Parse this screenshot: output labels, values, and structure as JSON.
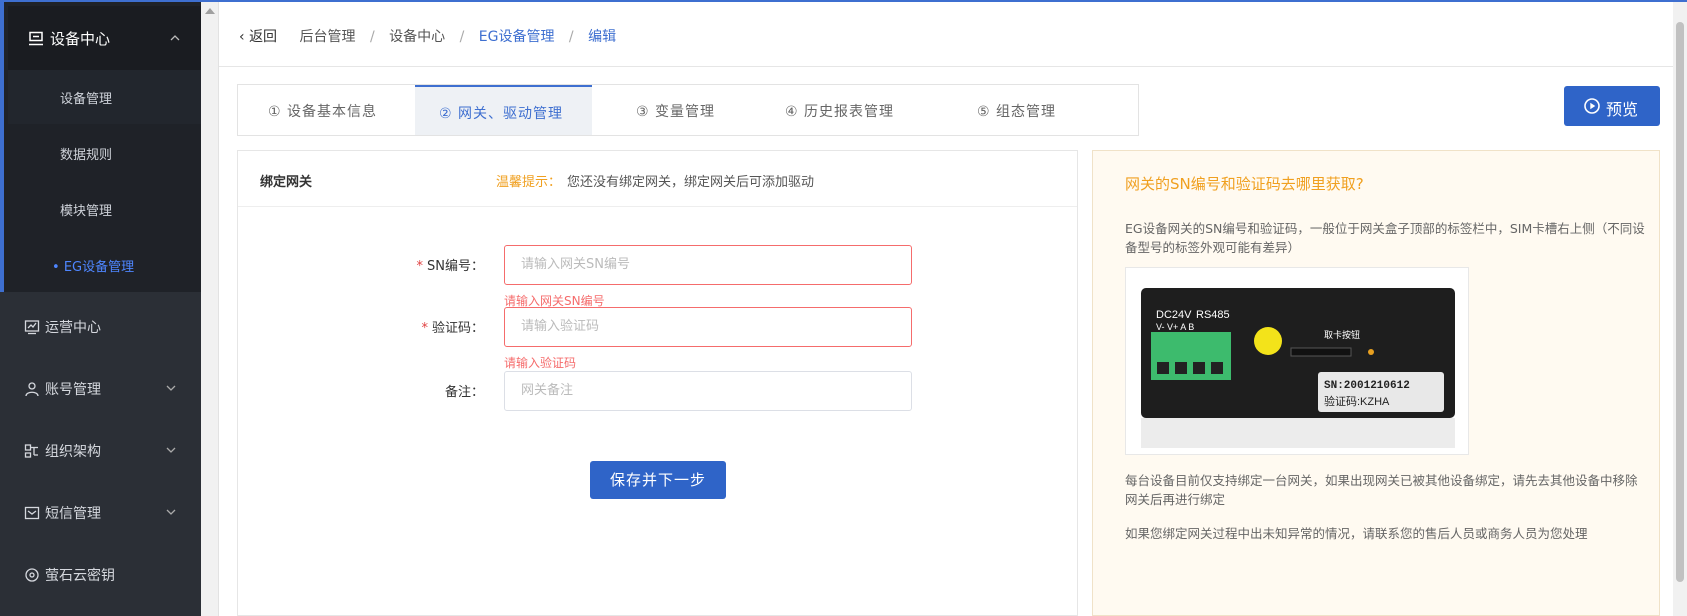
{
  "sidebar": {
    "open_group": {
      "label": "设备中心",
      "icon": "device-icon"
    },
    "sub_items": [
      {
        "label": "设备管理"
      },
      {
        "label": "数据规则"
      },
      {
        "label": "模块管理"
      },
      {
        "label": "EG设备管理",
        "active": true
      }
    ],
    "items": [
      {
        "label": "运营中心",
        "icon": "chart-icon",
        "has_chevron": false
      },
      {
        "label": "账号管理",
        "icon": "user-icon",
        "has_chevron": true
      },
      {
        "label": "组织架构",
        "icon": "org-icon",
        "has_chevron": true
      },
      {
        "label": "短信管理",
        "icon": "message-icon",
        "has_chevron": true
      },
      {
        "label": "萤石云密钥",
        "icon": "key-icon",
        "has_chevron": false
      }
    ]
  },
  "breadcrumb": {
    "back": "返回",
    "items": [
      "后台管理",
      "设备中心",
      "EG设备管理",
      "编辑"
    ]
  },
  "tabs": [
    {
      "label": "① 设备基本信息"
    },
    {
      "label": "② 网关、驱动管理",
      "active": true
    },
    {
      "label": "③ 变量管理"
    },
    {
      "label": "④ 历史报表管理"
    },
    {
      "label": "⑤ 组态管理"
    }
  ],
  "preview_button": "预览",
  "form": {
    "title": "绑定网关",
    "tip_label": "温馨提示：",
    "tip_text": "您还没有绑定网关，绑定网关后可添加驱动",
    "sn": {
      "label": "SN编号：",
      "placeholder": "请输入网关SN编号",
      "error": "请输入网关SN编号"
    },
    "code": {
      "label": "验证码：",
      "placeholder": "请输入验证码",
      "error": "请输入验证码"
    },
    "remark": {
      "label": "备注：",
      "placeholder": "网关备注"
    },
    "save_button": "保存并下一步"
  },
  "help": {
    "title": "网关的SN编号和验证码去哪里获取?",
    "p1": "EG设备网关的SN编号和验证码，一般位于网关盒子顶部的标签栏中，SIM卡槽右上侧（不同设备型号的标签外观可能有差异）",
    "device_labels": {
      "dc": "DC24V",
      "rs": "RS485",
      "terminals": "V-  V+   A    B",
      "card": "取卡按钮",
      "sn": "SN:2001210612",
      "code": "验证码:KZHA"
    },
    "p2": "每台设备目前仅支持绑定一台网关，如果出现网关已被其他设备绑定，请先去其他设备中移除网关后再进行绑定",
    "p3": "如果您绑定网关过程中出未知异常的情况，请联系您的售后人员或商务人员为您处理"
  }
}
